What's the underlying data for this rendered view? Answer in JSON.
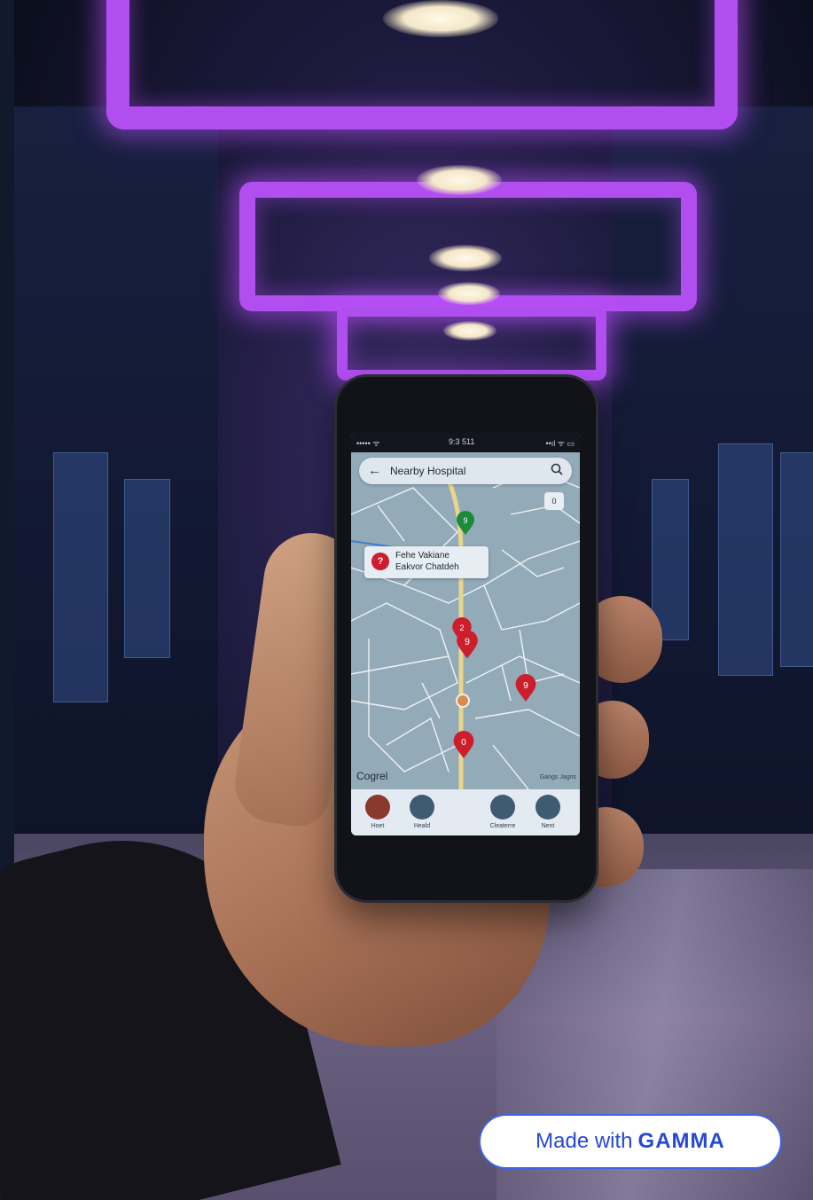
{
  "app": {
    "search_title": "Nearby Hospital",
    "back_icon": "arrow-left-icon",
    "search_icon": "search-icon"
  },
  "status_bar": {
    "left": "••••• ᯤ",
    "time": "9:3 511",
    "right": "••ıl ᯤ ▭"
  },
  "map": {
    "corner_button": "0",
    "callout": {
      "icon": "?",
      "line1": "Fehe Vakiane",
      "line2": "Eakvor Chatdeh"
    },
    "watermark": "Cogrel",
    "credit": "Gangs Jagns",
    "pins": [
      {
        "color": "#cc1e2b",
        "glyph": "2"
      },
      {
        "color": "#cc1e2b",
        "glyph": "9"
      },
      {
        "color": "#cc1e2b",
        "glyph": "9"
      },
      {
        "color": "#cc1e2b",
        "glyph": "0"
      },
      {
        "color": "#1b8a3b",
        "glyph": "9"
      }
    ]
  },
  "bottom_nav": [
    {
      "label": "Hoet",
      "icon": "profile-avatar-icon"
    },
    {
      "label": "Heald",
      "icon": "bag-icon"
    },
    {
      "label": "Cleaterre",
      "icon": "person-icon"
    },
    {
      "label": "Nent",
      "icon": "map-icon"
    }
  ],
  "badge": {
    "prefix": "Made with",
    "brand": "GAMMA"
  },
  "colors": {
    "neon": "#b14ef0",
    "pin_red": "#cc1e2b",
    "badge_blue": "#2549d6"
  }
}
